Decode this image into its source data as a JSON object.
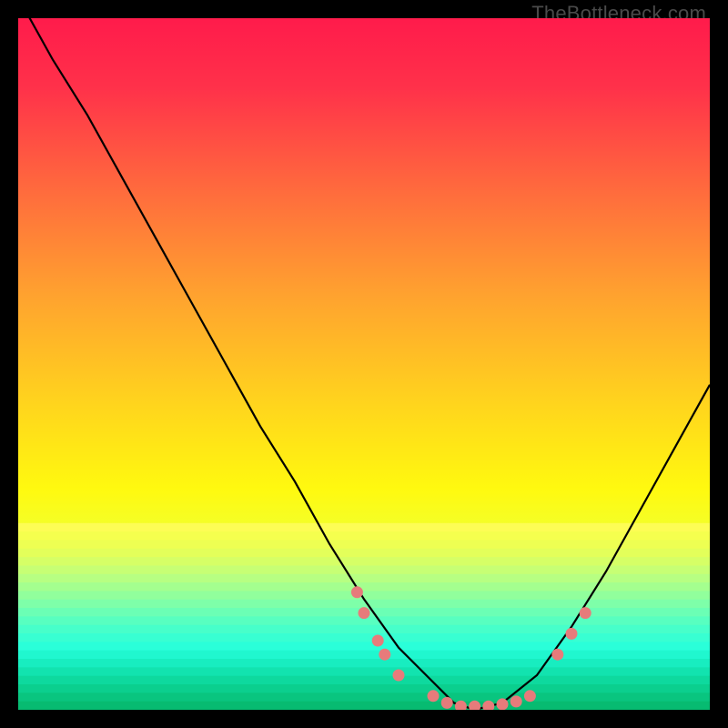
{
  "watermark": "TheBottleneck.com",
  "chart_data": {
    "type": "line",
    "title": "",
    "xlabel": "",
    "ylabel": "",
    "xlim": [
      0,
      100
    ],
    "ylim": [
      0,
      100
    ],
    "curve": {
      "name": "bottleneck-curve",
      "x": [
        0,
        5,
        10,
        15,
        20,
        25,
        30,
        35,
        40,
        45,
        50,
        55,
        60,
        63,
        66,
        70,
        75,
        80,
        85,
        90,
        95,
        100
      ],
      "y": [
        103,
        94,
        86,
        77,
        68,
        59,
        50,
        41,
        33,
        24,
        16,
        9,
        4,
        1,
        0,
        1,
        5,
        12,
        20,
        29,
        38,
        47
      ]
    },
    "markers": {
      "name": "sample-points",
      "color": "#e77b7b",
      "points": [
        {
          "x": 49,
          "y": 17
        },
        {
          "x": 50,
          "y": 14
        },
        {
          "x": 52,
          "y": 10
        },
        {
          "x": 53,
          "y": 8
        },
        {
          "x": 55,
          "y": 5
        },
        {
          "x": 60,
          "y": 2
        },
        {
          "x": 62,
          "y": 1
        },
        {
          "x": 64,
          "y": 0.5
        },
        {
          "x": 66,
          "y": 0.5
        },
        {
          "x": 68,
          "y": 0.5
        },
        {
          "x": 70,
          "y": 0.8
        },
        {
          "x": 72,
          "y": 1.2
        },
        {
          "x": 74,
          "y": 2
        },
        {
          "x": 78,
          "y": 8
        },
        {
          "x": 80,
          "y": 11
        },
        {
          "x": 82,
          "y": 14
        }
      ]
    },
    "gradient_stops": [
      {
        "offset": 0.0,
        "color": "#ff1b4b"
      },
      {
        "offset": 0.1,
        "color": "#ff314a"
      },
      {
        "offset": 0.25,
        "color": "#ff6b3d"
      },
      {
        "offset": 0.4,
        "color": "#ffa22f"
      },
      {
        "offset": 0.55,
        "color": "#ffd21e"
      },
      {
        "offset": 0.68,
        "color": "#fff90f"
      },
      {
        "offset": 0.74,
        "color": "#f3ff2a"
      },
      {
        "offset": 0.79,
        "color": "#d6ff66"
      },
      {
        "offset": 0.84,
        "color": "#9fff8f"
      },
      {
        "offset": 0.89,
        "color": "#5bffb0"
      },
      {
        "offset": 0.94,
        "color": "#2effc8"
      },
      {
        "offset": 1.0,
        "color": "#12e8a0"
      }
    ],
    "bottom_band": {
      "from_y": 73,
      "stripes": [
        "#fdfd55",
        "#f5ff4e",
        "#edff52",
        "#e3ff5a",
        "#d6ff66",
        "#c7ff74",
        "#b7ff82",
        "#a4ff8f",
        "#91ff9c",
        "#7effa9",
        "#6bffb5",
        "#58ffc0",
        "#47ffca",
        "#38ffd2",
        "#2affd9",
        "#20f7cf",
        "#18edc0",
        "#12e3af",
        "#0ed99e",
        "#0bcf8e",
        "#09c57f",
        "#07bb71"
      ]
    }
  }
}
